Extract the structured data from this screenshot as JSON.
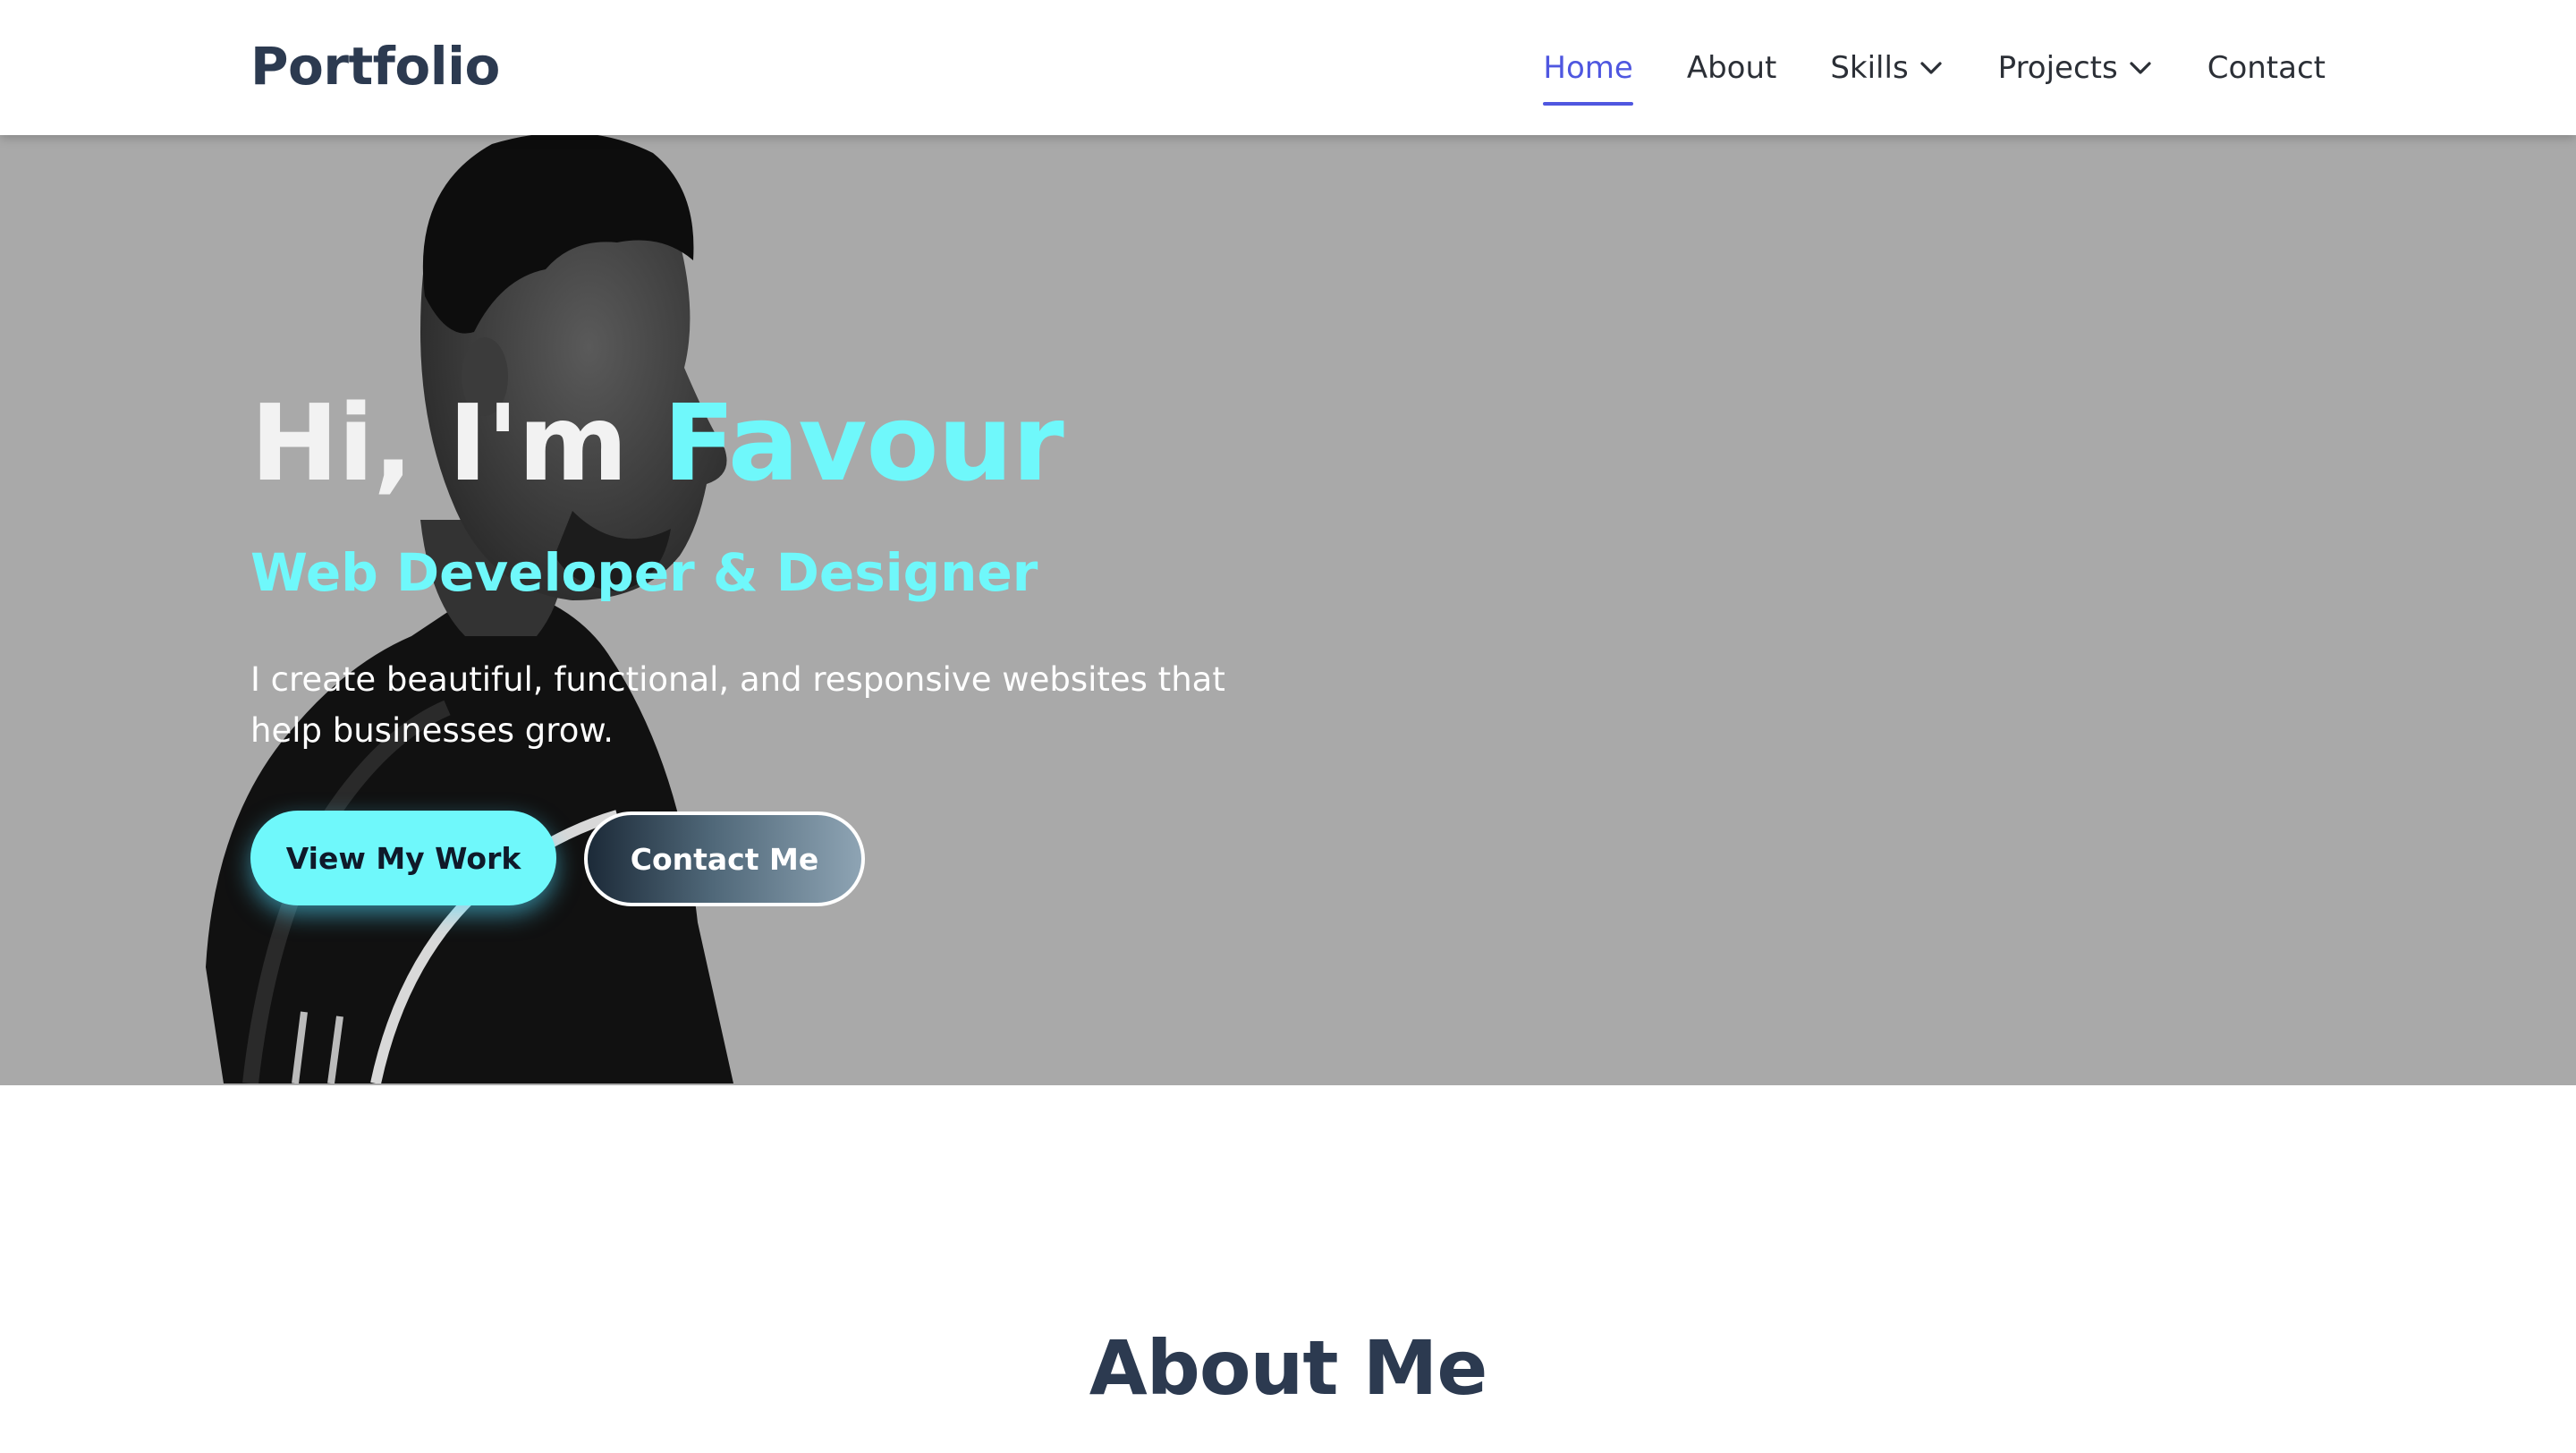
{
  "nav": {
    "logo": "Portfolio",
    "links": [
      {
        "label": "Home",
        "active": true
      },
      {
        "label": "About"
      },
      {
        "label": "Skills",
        "dropdown": true
      },
      {
        "label": "Projects",
        "dropdown": true
      },
      {
        "label": "Contact"
      }
    ],
    "icons": {
      "dropdown": "chevron-down-icon"
    }
  },
  "hero": {
    "greeting": "Hi, I'm",
    "name": "Favour",
    "subtitle": "Web Developer & Designer",
    "description": "I create beautiful, functional, and responsive websites that help businesses grow.",
    "primary_button": "View My Work",
    "secondary_button": "Contact Me"
  },
  "about": {
    "title": "About Me"
  },
  "colors": {
    "brand_dark": "#2c3a50",
    "accent_cyan": "#6ff8fb",
    "nav_active": "#4f57e0",
    "hero_bg": "#a9a9a9"
  }
}
